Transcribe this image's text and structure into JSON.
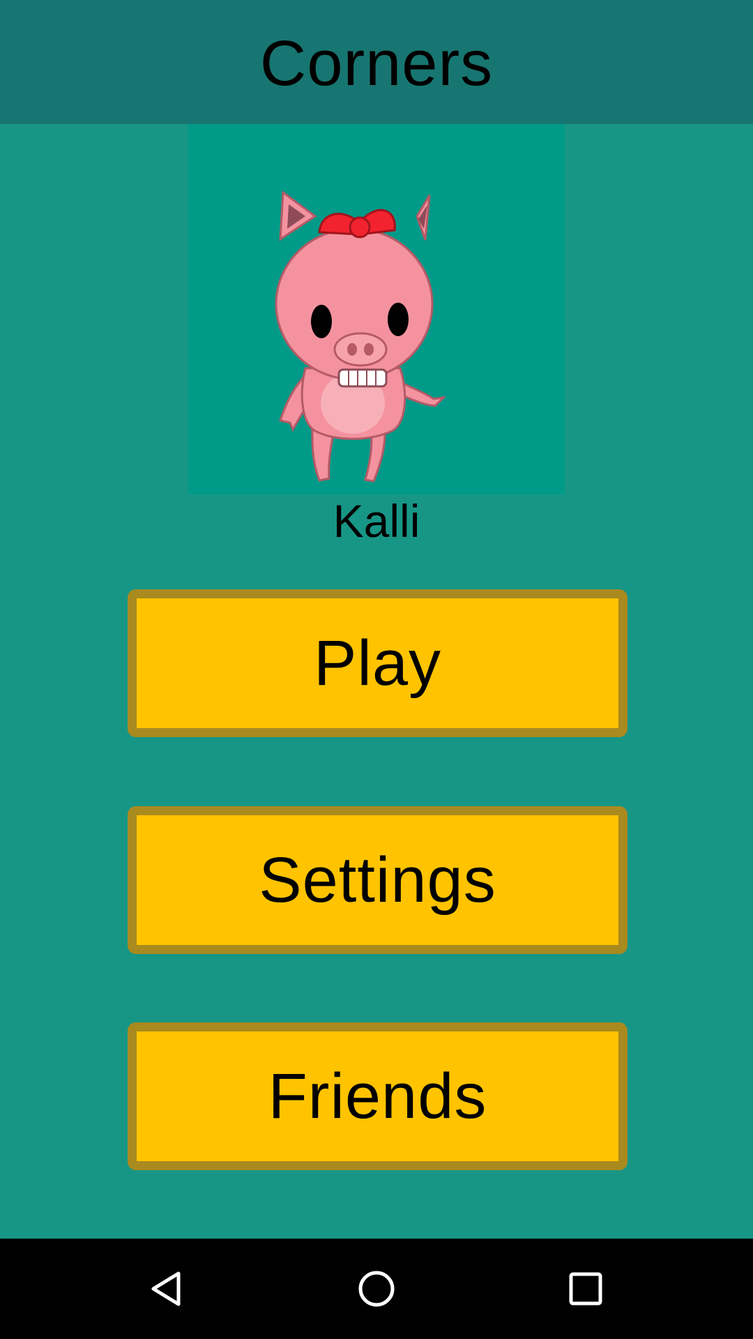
{
  "app_bar": {
    "title": "Corners"
  },
  "player": {
    "name": "Kalli",
    "avatar_icon": "pig-character"
  },
  "menu": {
    "play_label": "Play",
    "settings_label": "Settings",
    "friends_label": "Friends"
  },
  "navigation": {
    "back_icon": "triangle-back-icon",
    "home_icon": "circle-home-icon",
    "recents_icon": "square-recents-icon"
  },
  "colors": {
    "background": "#179686",
    "app_bar": "#177671",
    "avatar_panel": "#009a88",
    "button_fill": "#ffc300",
    "button_border": "#a98a1f"
  }
}
